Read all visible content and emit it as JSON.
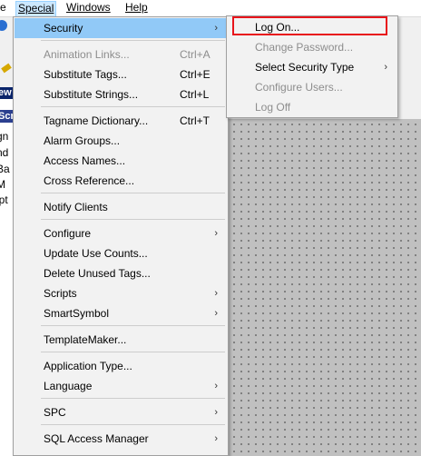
{
  "menubar": {
    "items": [
      {
        "label": "e"
      },
      {
        "label": "Special"
      },
      {
        "label": "Windows"
      },
      {
        "label": "Help"
      }
    ]
  },
  "background": {
    "panel_header": "ew",
    "panel_tab": "Scr",
    "tree_lines": [
      "gn",
      "nd",
      "Ba",
      "M",
      "ipt"
    ]
  },
  "menu": {
    "items": [
      {
        "label": "Security",
        "shortcut": "",
        "submenu": true,
        "disabled": false
      },
      {
        "label": "Animation Links...",
        "shortcut": "Ctrl+A",
        "submenu": false,
        "disabled": true
      },
      {
        "label": "Substitute Tags...",
        "shortcut": "Ctrl+E",
        "submenu": false,
        "disabled": false
      },
      {
        "label": "Substitute Strings...",
        "shortcut": "Ctrl+L",
        "submenu": false,
        "disabled": false
      },
      {
        "label": "Tagname Dictionary...",
        "shortcut": "Ctrl+T",
        "submenu": false,
        "disabled": false
      },
      {
        "label": "Alarm Groups...",
        "shortcut": "",
        "submenu": false,
        "disabled": false
      },
      {
        "label": "Access Names...",
        "shortcut": "",
        "submenu": false,
        "disabled": false
      },
      {
        "label": "Cross Reference...",
        "shortcut": "",
        "submenu": false,
        "disabled": false
      },
      {
        "label": "Notify Clients",
        "shortcut": "",
        "submenu": false,
        "disabled": false
      },
      {
        "label": "Configure",
        "shortcut": "",
        "submenu": true,
        "disabled": false
      },
      {
        "label": "Update Use Counts...",
        "shortcut": "",
        "submenu": false,
        "disabled": false
      },
      {
        "label": "Delete Unused Tags...",
        "shortcut": "",
        "submenu": false,
        "disabled": false
      },
      {
        "label": "Scripts",
        "shortcut": "",
        "submenu": true,
        "disabled": false
      },
      {
        "label": "SmartSymbol",
        "shortcut": "",
        "submenu": true,
        "disabled": false
      },
      {
        "label": "TemplateMaker...",
        "shortcut": "",
        "submenu": false,
        "disabled": false
      },
      {
        "label": "Application Type...",
        "shortcut": "",
        "submenu": false,
        "disabled": false
      },
      {
        "label": "Language",
        "shortcut": "",
        "submenu": true,
        "disabled": false
      },
      {
        "label": "SPC",
        "shortcut": "",
        "submenu": true,
        "disabled": false
      },
      {
        "label": "SQL Access Manager",
        "shortcut": "",
        "submenu": true,
        "disabled": false
      }
    ]
  },
  "submenu": {
    "items": [
      {
        "label": "Log On...",
        "disabled": false,
        "submenu": false
      },
      {
        "label": "Change Password...",
        "disabled": true,
        "submenu": false
      },
      {
        "label": "Select Security Type",
        "disabled": false,
        "submenu": true
      },
      {
        "label": "Configure Users...",
        "disabled": true,
        "submenu": false
      },
      {
        "label": "Log Off",
        "disabled": true,
        "submenu": false
      }
    ]
  },
  "icons": {
    "submenu_arrow": "chevron-right-icon",
    "help": "help-icon",
    "pencil": "pencil-icon"
  },
  "colors": {
    "highlight": "#91c9f7",
    "focus_box": "#e8141b",
    "menubar_active": "#cce8ff"
  }
}
